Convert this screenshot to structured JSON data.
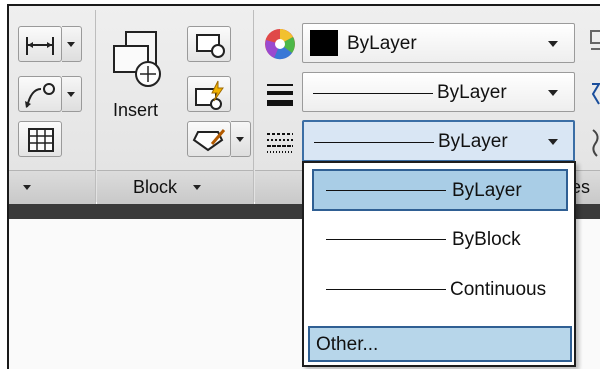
{
  "ribbon": {
    "insert_label": "Insert",
    "block_panel_label": "Block",
    "properties_panel_fragment": "es"
  },
  "properties": {
    "color_value": "ByLayer",
    "lineweight_value": "ByLayer",
    "linetype_value": "ByLayer"
  },
  "linetype_dropdown": {
    "items": [
      {
        "label": "ByLayer",
        "selected": true
      },
      {
        "label": "ByBlock",
        "selected": false
      },
      {
        "label": "Continuous",
        "selected": false
      }
    ],
    "other_label": "Other..."
  },
  "colors": {
    "selection_fill": "#a9cde6",
    "selection_border": "#2f5f93",
    "ribbon_bg": "#e6e6e6",
    "color_swatch": "#000000"
  }
}
